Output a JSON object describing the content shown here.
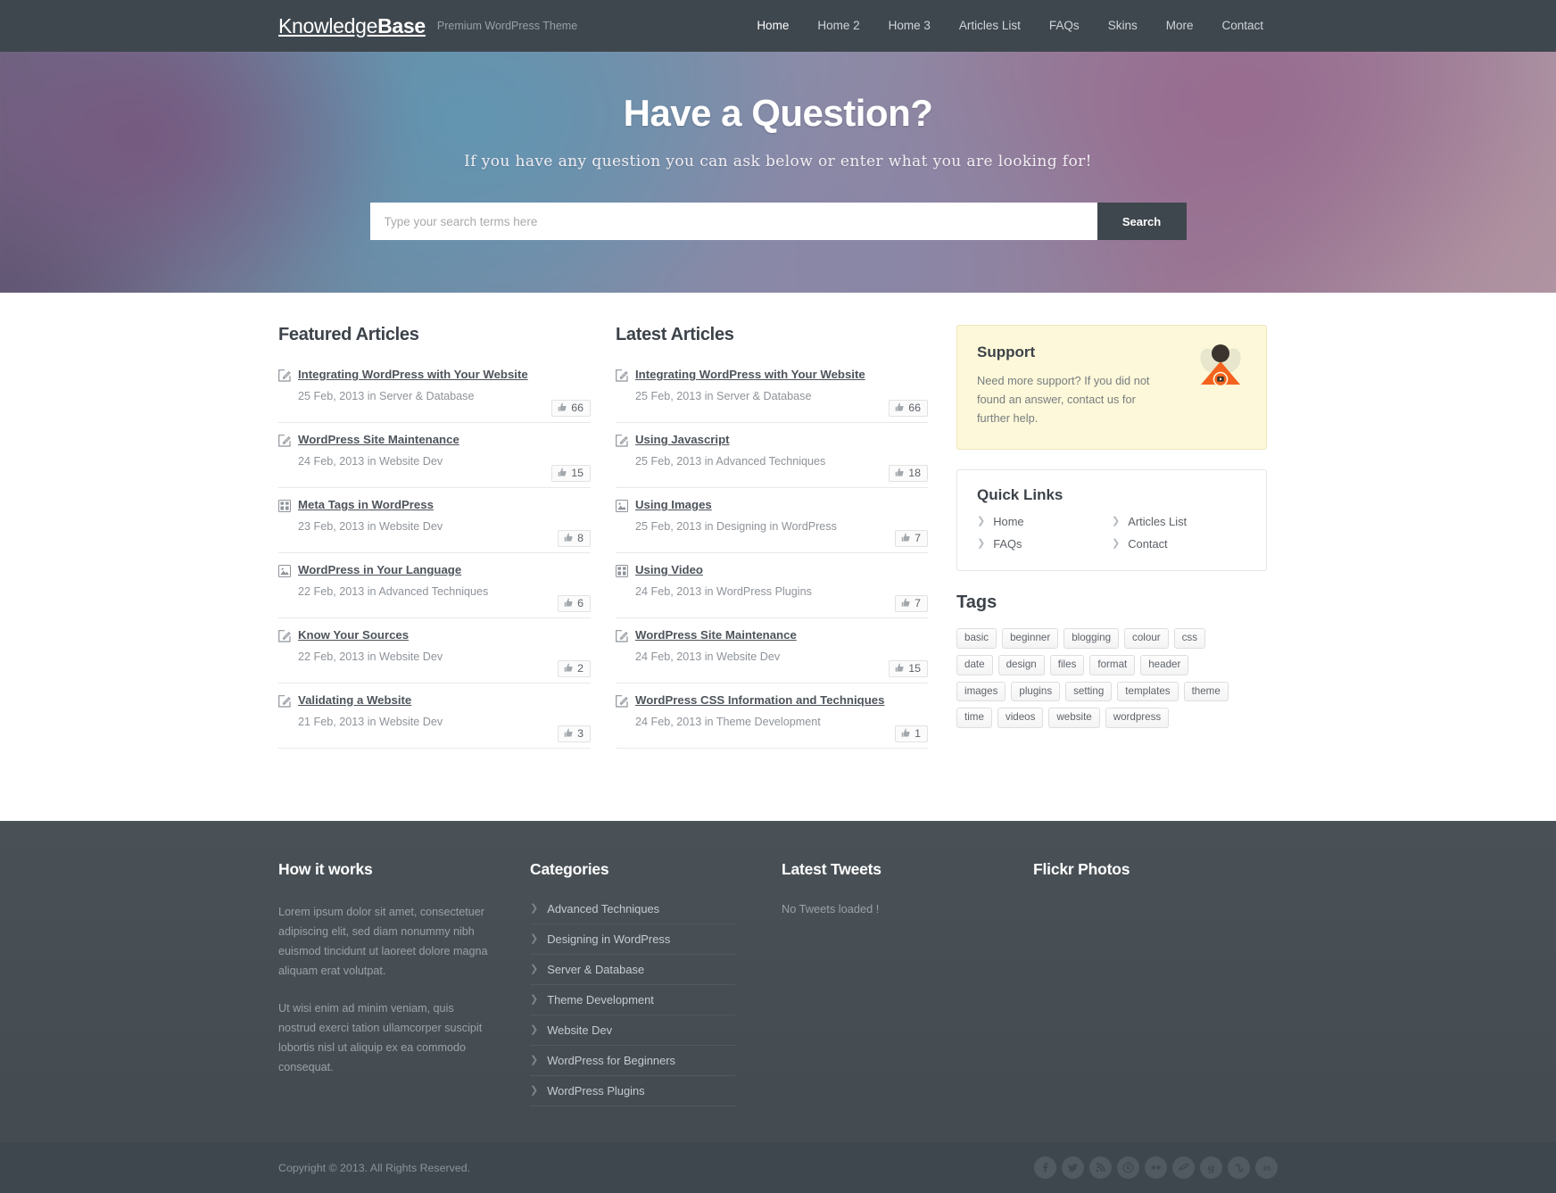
{
  "header": {
    "logo_light": "Knowledge",
    "logo_bold": "Base",
    "tagline": "Premium WordPress Theme",
    "nav": [
      {
        "label": "Home",
        "active": true
      },
      {
        "label": "Home 2",
        "active": false
      },
      {
        "label": "Home 3",
        "active": false
      },
      {
        "label": "Articles List",
        "active": false
      },
      {
        "label": "FAQs",
        "active": false
      },
      {
        "label": "Skins",
        "active": false
      },
      {
        "label": "More",
        "active": false
      },
      {
        "label": "Contact",
        "active": false
      }
    ]
  },
  "hero": {
    "title": "Have a Question?",
    "subtitle": "If you have any question you can ask below or enter what you are looking for!",
    "search_placeholder": "Type your search terms here",
    "search_value": "",
    "search_button": "Search"
  },
  "featured": {
    "title": "Featured Articles",
    "items": [
      {
        "icon": "edit-icon",
        "title": "Integrating WordPress with Your Website",
        "date": "25 Feb, 2013",
        "in": "in",
        "category": "Server & Database",
        "likes": "66"
      },
      {
        "icon": "edit-icon",
        "title": "WordPress Site Maintenance",
        "date": "24 Feb, 2013",
        "in": "in",
        "category": "Website Dev",
        "likes": "15"
      },
      {
        "icon": "grid-icon",
        "title": "Meta Tags in WordPress",
        "date": "23 Feb, 2013",
        "in": "in",
        "category": "Website Dev",
        "likes": "8"
      },
      {
        "icon": "image-icon",
        "title": "WordPress in Your Language",
        "date": "22 Feb, 2013",
        "in": "in",
        "category": "Advanced Techniques",
        "likes": "6"
      },
      {
        "icon": "edit-icon",
        "title": "Know Your Sources",
        "date": "22 Feb, 2013",
        "in": "in",
        "category": "Website Dev",
        "likes": "2"
      },
      {
        "icon": "edit-icon",
        "title": "Validating a Website",
        "date": "21 Feb, 2013",
        "in": "in",
        "category": "Website Dev",
        "likes": "3"
      }
    ]
  },
  "latest": {
    "title": "Latest Articles",
    "items": [
      {
        "icon": "edit-icon",
        "title": "Integrating WordPress with Your Website",
        "date": "25 Feb, 2013",
        "in": "in",
        "category": "Server & Database",
        "likes": "66"
      },
      {
        "icon": "edit-icon",
        "title": "Using Javascript",
        "date": "25 Feb, 2013",
        "in": "in",
        "category": "Advanced Techniques",
        "likes": "18"
      },
      {
        "icon": "image-icon",
        "title": "Using Images",
        "date": "25 Feb, 2013",
        "in": "in",
        "category": "Designing in WordPress",
        "likes": "7"
      },
      {
        "icon": "grid-icon",
        "title": "Using Video",
        "date": "24 Feb, 2013",
        "in": "in",
        "category": "WordPress Plugins",
        "likes": "7"
      },
      {
        "icon": "edit-icon",
        "title": "WordPress Site Maintenance",
        "date": "24 Feb, 2013",
        "in": "in",
        "category": "Website Dev",
        "likes": "15"
      },
      {
        "icon": "edit-icon",
        "title": "WordPress CSS Information and Techniques",
        "date": "24 Feb, 2013",
        "in": "in",
        "category": "Theme Development",
        "likes": "1"
      }
    ]
  },
  "sidebar": {
    "support": {
      "title": "Support",
      "text": "Need more support? If you did not found an answer, contact us for further help.",
      "bg_color": "#fcf8d9",
      "accent_color": "#f4631e"
    },
    "quick_links": {
      "title": "Quick Links",
      "items": [
        "Home",
        "Articles List",
        "FAQs",
        "Contact"
      ]
    },
    "tags": {
      "title": "Tags",
      "items": [
        "basic",
        "beginner",
        "blogging",
        "colour",
        "css",
        "date",
        "design",
        "files",
        "format",
        "header",
        "images",
        "plugins",
        "setting",
        "templates",
        "theme",
        "time",
        "videos",
        "website",
        "wordpress"
      ]
    }
  },
  "footer": {
    "how_it_works": {
      "title": "How it works",
      "paragraphs": [
        "Lorem ipsum dolor sit amet, consectetuer adipiscing elit, sed diam nonummy nibh euismod tincidunt ut laoreet dolore magna aliquam erat volutpat.",
        "Ut wisi enim ad minim veniam, quis nostrud exerci tation ullamcorper suscipit lobortis nisl ut aliquip ex ea commodo consequat."
      ]
    },
    "categories": {
      "title": "Categories",
      "items": [
        "Advanced Techniques",
        "Designing in WordPress",
        "Server & Database",
        "Theme Development",
        "Website Dev",
        "WordPress for Beginners",
        "WordPress Plugins"
      ]
    },
    "tweets": {
      "title": "Latest Tweets",
      "empty": "No Tweets loaded !"
    },
    "flickr": {
      "title": "Flickr Photos"
    },
    "copyright": "Copyright © 2013. All Rights Reserved.",
    "socials": [
      "facebook-icon",
      "twitter-icon",
      "rss-icon",
      "skype-icon",
      "flickr-icon",
      "dribbble-icon",
      "google-icon",
      "stumbleupon-icon",
      "linkedin-icon"
    ]
  },
  "colors": {
    "nav_bg": "#3f474e",
    "footer_bg": "#474f55",
    "heading": "#3d434a",
    "support_bg": "#fcf8d9"
  }
}
